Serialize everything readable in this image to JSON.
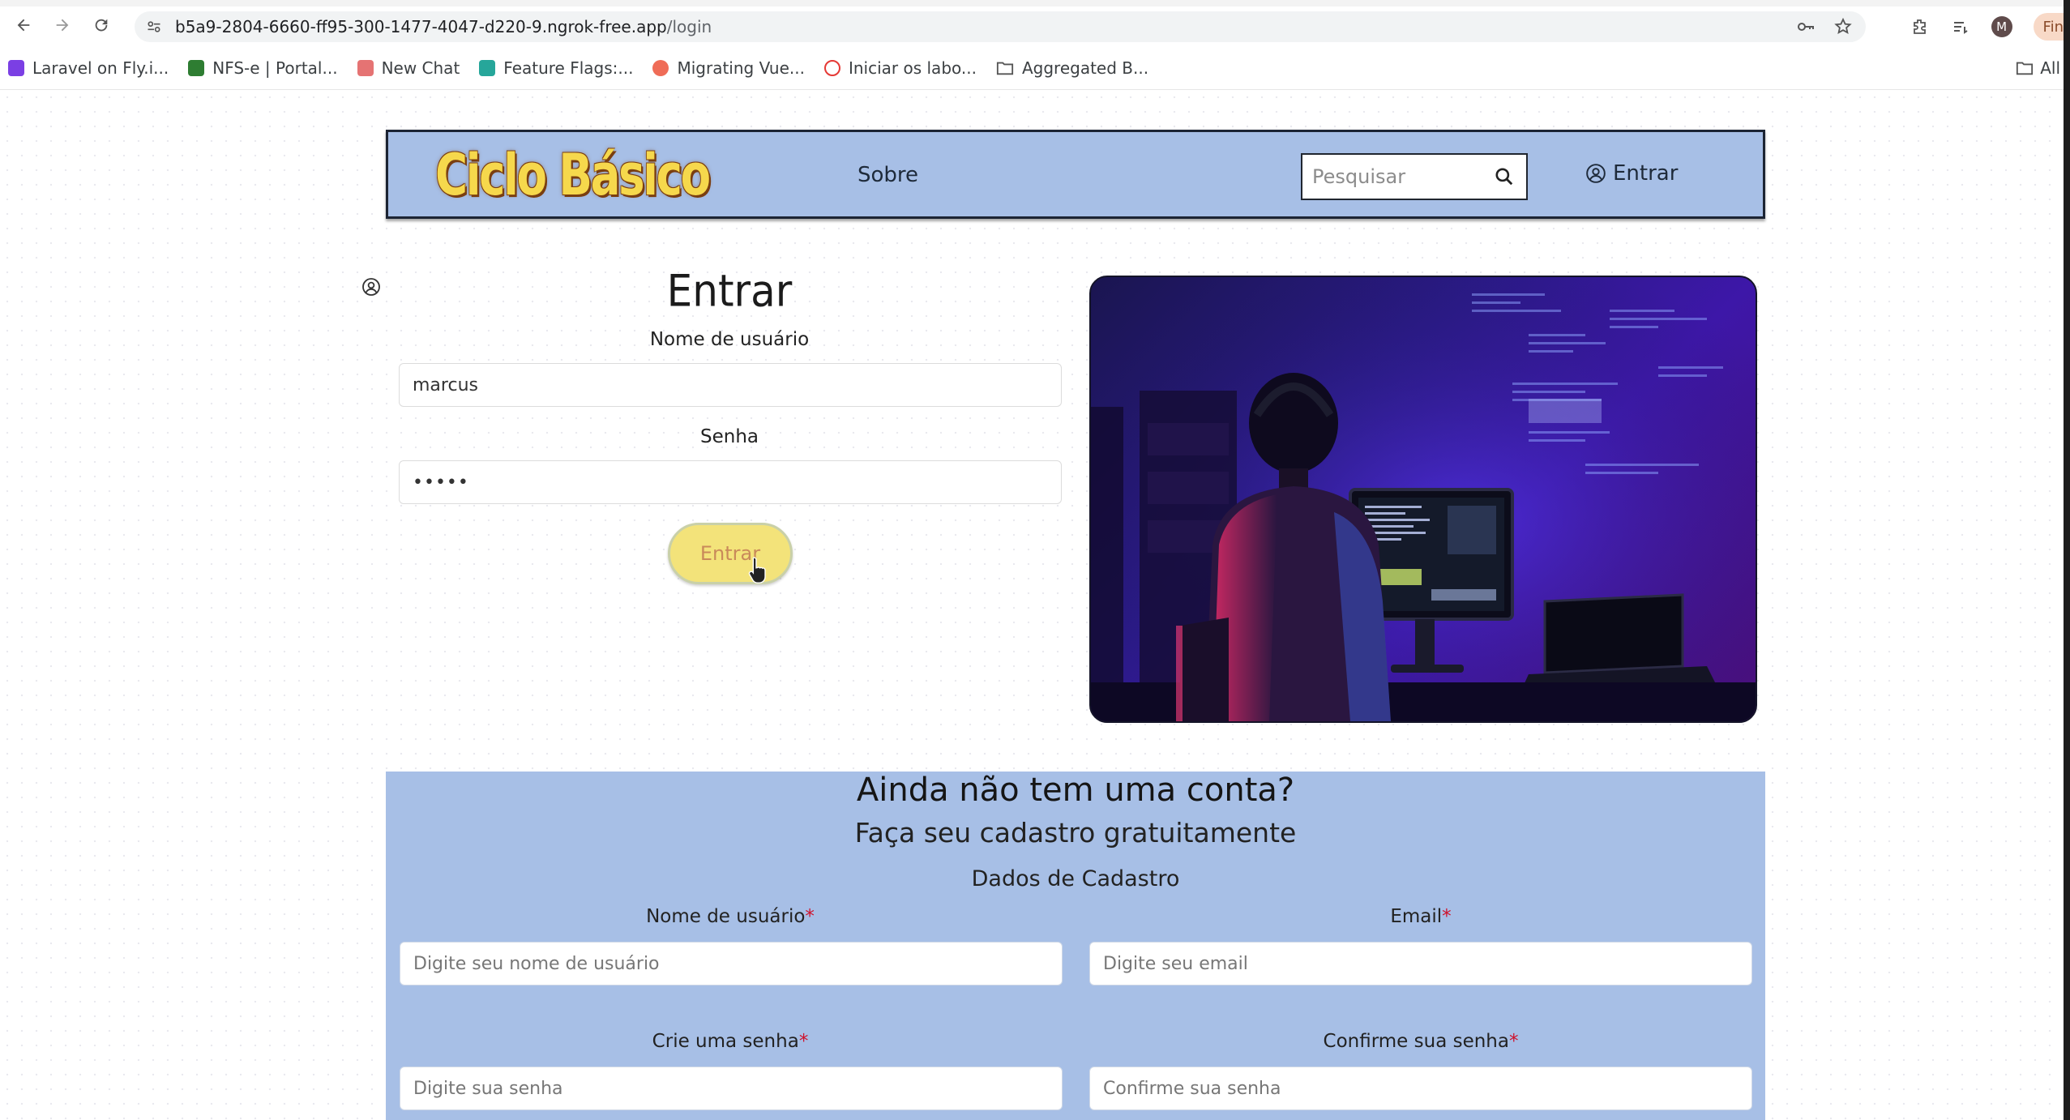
{
  "browser": {
    "url_host": "b5a9-2804-6660-ff95-300-1477-4047-d220-9.ngrok-free.app",
    "url_path": "/login",
    "profile_initial": "M",
    "profile_chip": "Fin",
    "bookmarks": [
      {
        "label": "Laravel on Fly.i...",
        "color": "#7b3fe4"
      },
      {
        "label": "NFS-e | Portal...",
        "color": "#2e7d32"
      },
      {
        "label": "New Chat",
        "color": "#e57373"
      },
      {
        "label": "Feature Flags:...",
        "color": "#26a69a"
      },
      {
        "label": "Migrating Vue...",
        "color": "#ef6c57"
      },
      {
        "label": "Iniciar os labo...",
        "color": "#e53935"
      },
      {
        "label": "Aggregated B...",
        "color": "#5f6368"
      }
    ],
    "all_bookmarks": "All"
  },
  "header": {
    "logo": "Ciclo Básico",
    "nav_about": "Sobre",
    "search_placeholder": "Pesquisar",
    "login_link": "Entrar"
  },
  "login": {
    "title": "Entrar",
    "username_label": "Nome de usuário",
    "username_value": "marcus",
    "password_label": "Senha",
    "password_value": "•••••",
    "submit": "Entrar"
  },
  "signup": {
    "heading": "Ainda não tem uma conta?",
    "subheading": "Faça seu cadastro gratuitamente",
    "section": "Dados de Cadastro",
    "required_mark": "*",
    "username_label": "Nome de usuário",
    "username_placeholder": "Digite seu nome de usuário",
    "email_label": "Email",
    "email_placeholder": "Digite seu email",
    "password_label": "Crie uma senha",
    "password_placeholder": "Digite sua senha",
    "confirm_label": "Confirme sua senha",
    "confirm_placeholder": "Confirme sua senha"
  },
  "colors": {
    "header_bg": "#a7bfe6",
    "button_bg": "#f3e37a",
    "required": "#d0112b"
  }
}
